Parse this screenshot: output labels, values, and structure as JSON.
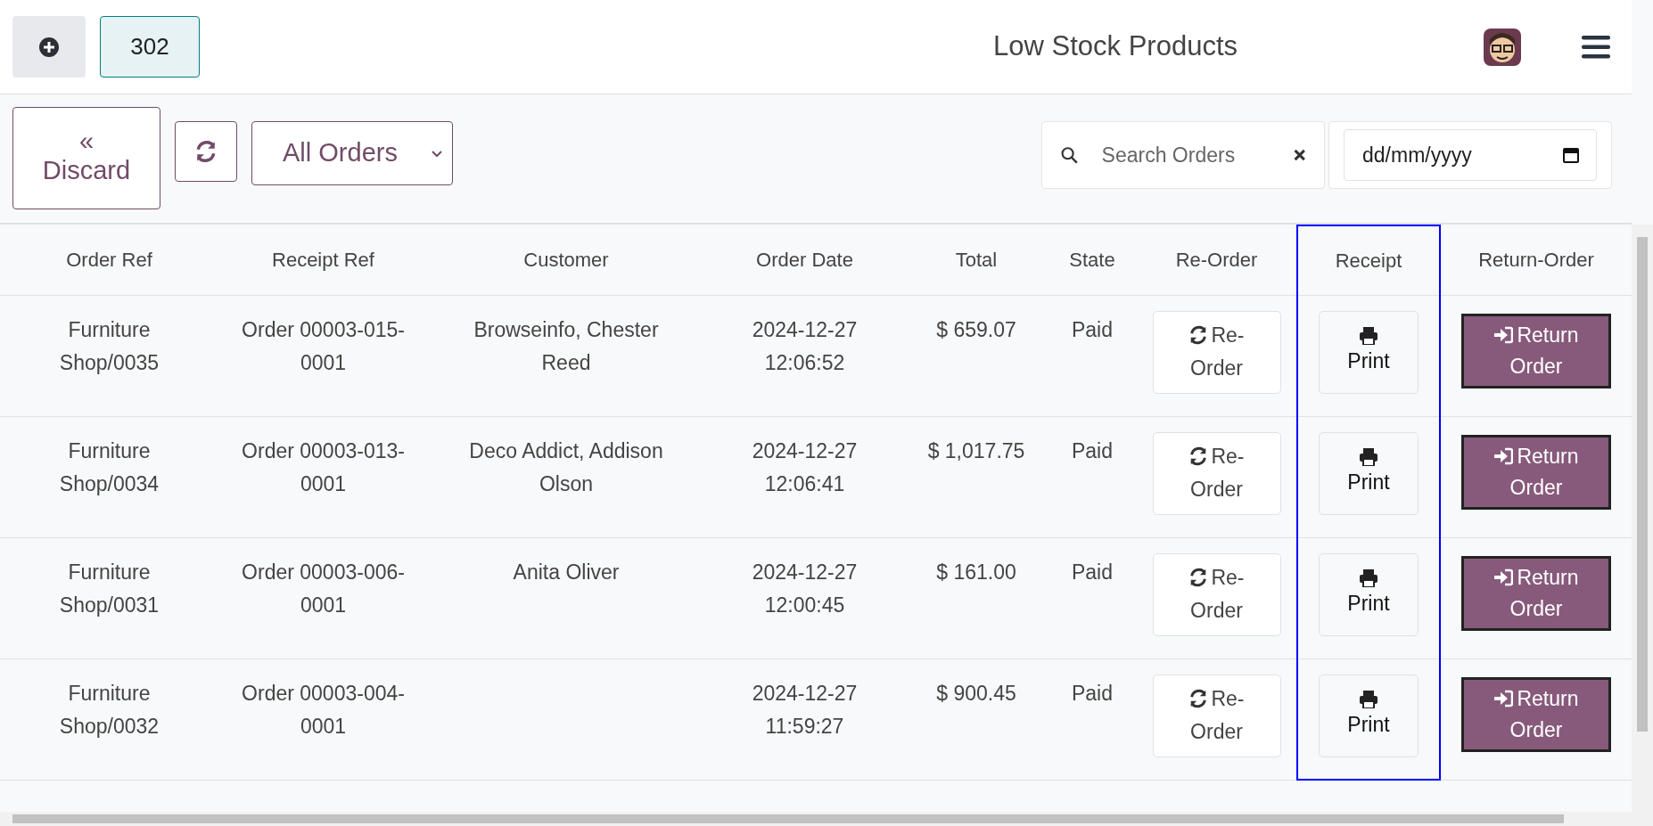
{
  "header": {
    "count": "302",
    "title": "Low Stock Products"
  },
  "toolbar": {
    "discard": {
      "icon": "«",
      "label": "Discard"
    },
    "filter": "All Orders",
    "search": {
      "placeholder": "Search Orders"
    },
    "date": {
      "placeholder": "dd/mm/yyyy"
    }
  },
  "table": {
    "columns": [
      {
        "label": "Order Ref",
        "highlighted": false
      },
      {
        "label": "Receipt Ref",
        "highlighted": false
      },
      {
        "label": "Customer",
        "highlighted": false
      },
      {
        "label": "Order Date",
        "highlighted": false
      },
      {
        "label": "Total",
        "highlighted": false
      },
      {
        "label": "State",
        "highlighted": false
      },
      {
        "label": "Re-Order",
        "highlighted": false
      },
      {
        "label": "Receipt",
        "highlighted": true
      },
      {
        "label": "Return-Order",
        "highlighted": false
      }
    ],
    "rows": [
      {
        "order_ref": "Furniture Shop/0035",
        "receipt_ref": "Order 00003-015-0001",
        "customer": "Browseinfo, Chester Reed",
        "order_date": "2024-12-27 12:06:52",
        "total": "$ 659.07",
        "state": "Paid",
        "reorder": "Re-Order",
        "print": "Print",
        "return": "Return Order"
      },
      {
        "order_ref": "Furniture Shop/0034",
        "receipt_ref": "Order 00003-013-0001",
        "customer": "Deco Addict, Addison Olson",
        "order_date": "2024-12-27 12:06:41",
        "total": "$ 1,017.75",
        "state": "Paid",
        "reorder": "Re-Order",
        "print": "Print",
        "return": "Return Order"
      },
      {
        "order_ref": "Furniture Shop/0031",
        "receipt_ref": "Order 00003-006-0001",
        "customer": "Anita Oliver",
        "order_date": "2024-12-27 12:00:45",
        "total": "$ 161.00",
        "state": "Paid",
        "reorder": "Re-Order",
        "print": "Print",
        "return": "Return Order"
      },
      {
        "order_ref": "Furniture Shop/0032",
        "receipt_ref": "Order 00003-004-0001",
        "customer": "",
        "order_date": "2024-12-27 11:59:27",
        "total": "$ 900.45",
        "state": "Paid",
        "reorder": "Re-Order",
        "print": "Print",
        "return": "Return Order"
      }
    ]
  }
}
